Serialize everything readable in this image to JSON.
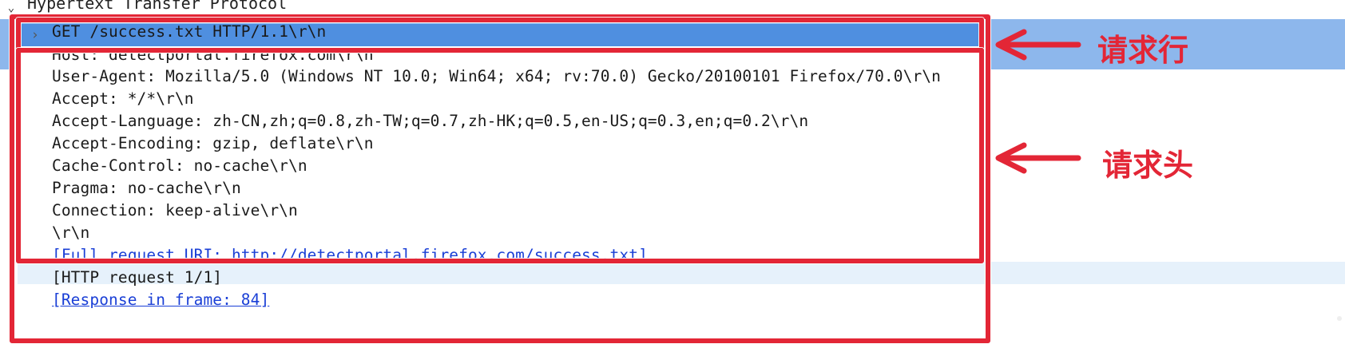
{
  "tree": {
    "header_label": "Hypertext Transfer Protocol",
    "request_line": "GET /success.txt HTTP/1.1\\r\\n",
    "headers": [
      "Host: detectportal.firefox.com\\r\\n",
      "User-Agent: Mozilla/5.0 (Windows NT 10.0; Win64; x64; rv:70.0) Gecko/20100101 Firefox/70.0\\r\\n",
      "Accept: */*\\r\\n",
      "Accept-Language: zh-CN,zh;q=0.8,zh-TW;q=0.7,zh-HK;q=0.5,en-US;q=0.3,en;q=0.2\\r\\n",
      "Accept-Encoding: gzip, deflate\\r\\n",
      "Cache-Control: no-cache\\r\\n",
      "Pragma: no-cache\\r\\n",
      "Connection: keep-alive\\r\\n",
      "\\r\\n"
    ],
    "full_request_uri": "[Full request URI: http://detectportal.firefox.com/success.txt]",
    "http_request_count": "[HTTP request 1/1]",
    "response_in_frame": "[Response in frame: 84]"
  },
  "annotations": {
    "request_line_label": "请求行",
    "request_header_label": "请求头"
  },
  "colors": {
    "annotation_red": "#e32636",
    "selection_blue": "#8db7ec",
    "link_blue": "#1a3fd6"
  },
  "icons": {
    "header_expander": "chevron-down-icon",
    "row_expander": "chevron-right-icon",
    "annotation_arrow": "arrow-left-icon"
  }
}
